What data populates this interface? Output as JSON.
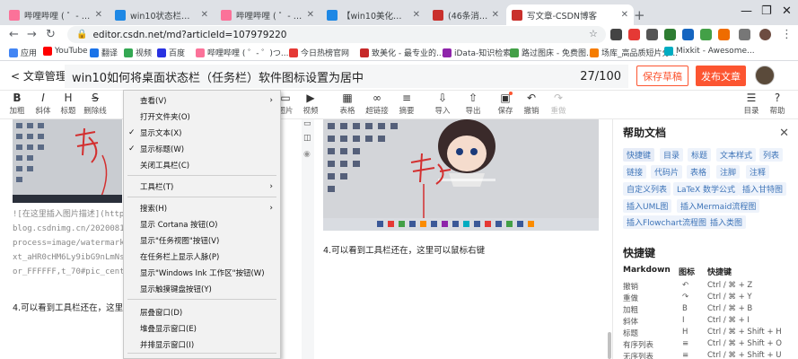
{
  "tabs": [
    {
      "title": "哔哩哔哩 ( ゜- ゜)つロ 干杯~-bili",
      "color": "#fb7299"
    },
    {
      "title": "win10状态栏居中 - 搜索结果 - 哔",
      "color": "#1e88e5"
    },
    {
      "title": "哔哩哔哩 ( ゜- ゜)つロ 干杯~-bili",
      "color": "#fb7299"
    },
    {
      "title": "【win10美化】一分钟你就可以让",
      "color": "#1e88e5"
    },
    {
      "title": "(46条消息)CSDN - 专业开发者社",
      "color": "#c9302c"
    },
    {
      "title": "写文章-CSDN博客",
      "color": "#c9302c"
    }
  ],
  "address": {
    "url": "editor.csdn.net/md?articleId=107979220"
  },
  "bookmarks": [
    {
      "label": "应用",
      "color": "#4285f4"
    },
    {
      "label": "YouTube",
      "color": "#ff0000"
    },
    {
      "label": "翻译",
      "color": "#1a73e8"
    },
    {
      "label": "视频",
      "color": "#34a853"
    },
    {
      "label": "百度",
      "color": "#2932e1"
    },
    {
      "label": "哔哩哔哩 ( ゜- ゜)つ...",
      "color": "#fb7299"
    },
    {
      "label": "今日热榜官网",
      "color": "#e53935"
    },
    {
      "label": "致美化 - 最专业的...",
      "color": "#c62828"
    },
    {
      "label": "iData-知识检索",
      "color": "#8e24aa"
    },
    {
      "label": "路过图床 - 免费图...",
      "color": "#43a047"
    },
    {
      "label": "场库_高品质短片分...",
      "color": "#f57c00"
    },
    {
      "label": "Mixkit - Awesome...",
      "color": "#00acc1"
    }
  ],
  "editor": {
    "back_label": "< 文章管理",
    "title": "win10如何将桌面状态栏（任务栏）软件图标设置为居中",
    "count": "27/100",
    "save_draft": "保存草稿",
    "publish": "发布文章"
  },
  "toolbar": [
    {
      "icon": "B",
      "label": "加粗",
      "name": "bold"
    },
    {
      "icon": "I",
      "label": "斜体",
      "name": "italic"
    },
    {
      "icon": "H",
      "label": "标题",
      "name": "heading"
    },
    {
      "icon": "S",
      "label": "删除线",
      "name": "strikethrough"
    },
    {
      "icon": "▭",
      "label": "图片",
      "name": "image"
    },
    {
      "icon": "▶",
      "label": "视频",
      "name": "video"
    },
    {
      "icon": "▦",
      "label": "表格",
      "name": "table"
    },
    {
      "icon": "∞",
      "label": "超链接",
      "name": "link"
    },
    {
      "icon": "≡",
      "label": "摘要",
      "name": "summary"
    },
    {
      "icon": "⇩",
      "label": "导入",
      "name": "import"
    },
    {
      "icon": "⇧",
      "label": "导出",
      "name": "export"
    },
    {
      "icon": "▣",
      "label": "保存",
      "name": "save"
    },
    {
      "icon": "↶",
      "label": "撤销",
      "name": "undo"
    },
    {
      "icon": "↷",
      "label": "重做",
      "name": "redo"
    },
    {
      "icon": "☰",
      "label": "目录",
      "name": "toc"
    },
    {
      "icon": "?",
      "label": "帮助",
      "name": "help"
    }
  ],
  "left_pane": {
    "md_lines": [
      "![在这里插入图片描述](https://",
      "blog.csdnimg.cn/2020081314",
      "process=image/watermark,typ",
      "xt_aHR0cHM6Ly9ibG9nLmNsdte",
      "or_FFFFFF,t_70#pic_center)"
    ],
    "paragraph": "4.可以看到工具栏还在，这里可"
  },
  "right_pane": {
    "paragraph": "4.可以看到工具栏还在，这里可以鼠标右键"
  },
  "context_menu": [
    {
      "label": "查看(V)",
      "check": "",
      "arrow": "›"
    },
    {
      "label": "打开文件夹(O)",
      "check": "",
      "arrow": ""
    },
    {
      "label": "显示文本(X)",
      "check": "✓",
      "arrow": ""
    },
    {
      "label": "显示标题(W)",
      "check": "✓",
      "arrow": ""
    },
    {
      "label": "关闭工具栏(C)",
      "check": "",
      "arrow": ""
    },
    {
      "label": "工具栏(T)",
      "check": "",
      "arrow": "›"
    },
    {
      "label": "搜索(H)",
      "check": "",
      "arrow": "›"
    },
    {
      "label": "显示 Cortana 按钮(O)",
      "check": "",
      "arrow": ""
    },
    {
      "label": "显示\"任务视图\"按钮(V)",
      "check": "",
      "arrow": ""
    },
    {
      "label": "在任务栏上显示人脉(P)",
      "check": "",
      "arrow": ""
    },
    {
      "label": "显示\"Windows Ink 工作区\"按钮(W)",
      "check": "",
      "arrow": ""
    },
    {
      "label": "显示触摸键盘按钮(Y)",
      "check": "",
      "arrow": ""
    },
    {
      "label": "层叠窗口(D)",
      "check": "",
      "arrow": ""
    },
    {
      "label": "堆叠显示窗口(E)",
      "check": "",
      "arrow": ""
    },
    {
      "label": "并排显示窗口(I)",
      "check": "",
      "arrow": ""
    }
  ],
  "help": {
    "title": "帮助文档",
    "tags": [
      "快捷键",
      "目录",
      "标题",
      "文本样式",
      "列表",
      "链接",
      "代码片",
      "表格",
      "注脚",
      "注释",
      "自定义列表",
      "LaTeX 数学公式",
      "插入甘特图",
      "插入UML图",
      "插入Mermaid流程图",
      "插入Flowchart流程图",
      "插入类图"
    ],
    "shortcuts_title": "快捷键",
    "columns": [
      "Markdown",
      "图标",
      "快捷键"
    ],
    "rows": [
      {
        "name": "撤销",
        "icon": "↶",
        "key": "Ctrl / ⌘ + Z"
      },
      {
        "name": "重做",
        "icon": "↷",
        "key": "Ctrl / ⌘ + Y"
      },
      {
        "name": "加粗",
        "icon": "B",
        "key": "Ctrl / ⌘ + B"
      },
      {
        "name": "斜体",
        "icon": "I",
        "key": "Ctrl / ⌘ + I"
      },
      {
        "name": "标题",
        "icon": "H",
        "key": "Ctrl / ⌘ + Shift + H"
      },
      {
        "name": "有序列表",
        "icon": "≡",
        "key": "Ctrl / ⌘ + Shift + O"
      },
      {
        "name": "无序列表",
        "icon": "≡",
        "key": "Ctrl / ⌘ + Shift + U"
      }
    ]
  },
  "screenshot_text": {
    "handwriting": "拉它"
  }
}
